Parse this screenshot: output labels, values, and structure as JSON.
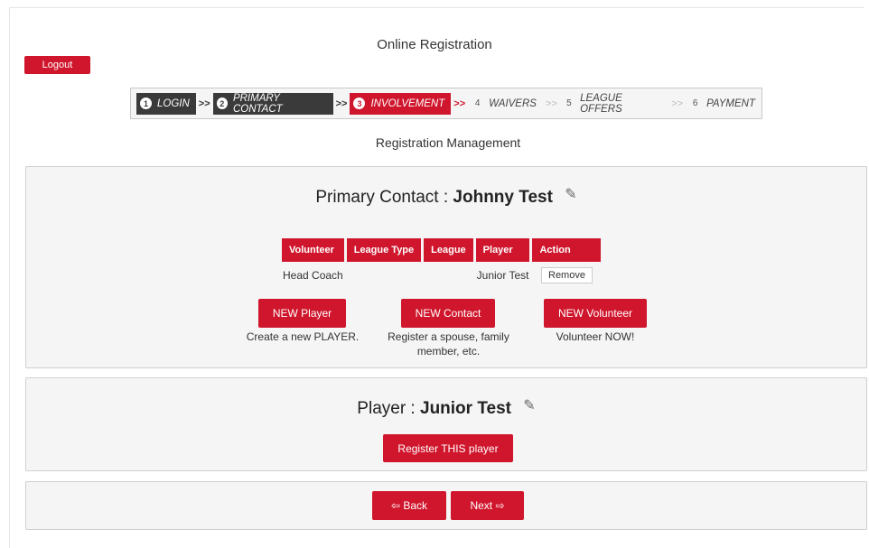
{
  "header": {
    "title": "Online Registration",
    "logout_label": "Logout",
    "subtitle": "Registration Management"
  },
  "steps": [
    {
      "num": "1",
      "label": "LOGIN",
      "state": "done"
    },
    {
      "num": "2",
      "label": "PRIMARY CONTACT",
      "state": "done"
    },
    {
      "num": "3",
      "label": "INVOLVEMENT",
      "state": "active"
    },
    {
      "num": "4",
      "label": "WAIVERS",
      "state": "todo"
    },
    {
      "num": "5",
      "label": "LEAGUE OFFERS",
      "state": "todo"
    },
    {
      "num": "6",
      "label": "PAYMENT",
      "state": "todo"
    }
  ],
  "step_separator": ">>",
  "primary_contact": {
    "label": "Primary Contact :",
    "name": "Johnny Test",
    "table": {
      "headers": [
        "Volunteer",
        "League Type",
        "League",
        "Player",
        "Action"
      ],
      "rows": [
        {
          "volunteer": "Head Coach",
          "league_type": "",
          "league": "",
          "player": "Junior Test",
          "action": "Remove"
        }
      ]
    },
    "buttons": {
      "new_player": {
        "label": "NEW Player",
        "caption": "Create a new PLAYER."
      },
      "new_contact": {
        "label": "NEW Contact",
        "caption": "Register a spouse, family member, etc."
      },
      "new_volunteer": {
        "label": "NEW Volunteer",
        "caption": "Volunteer NOW!"
      }
    }
  },
  "player": {
    "label": "Player :",
    "name": "Junior Test",
    "register_label": "Register THIS player"
  },
  "nav": {
    "back_label": "Back",
    "next_label": "Next"
  },
  "colors": {
    "accent": "#d0162c",
    "done_step": "#3a3a3a",
    "panel_bg": "#f5f5f5"
  }
}
